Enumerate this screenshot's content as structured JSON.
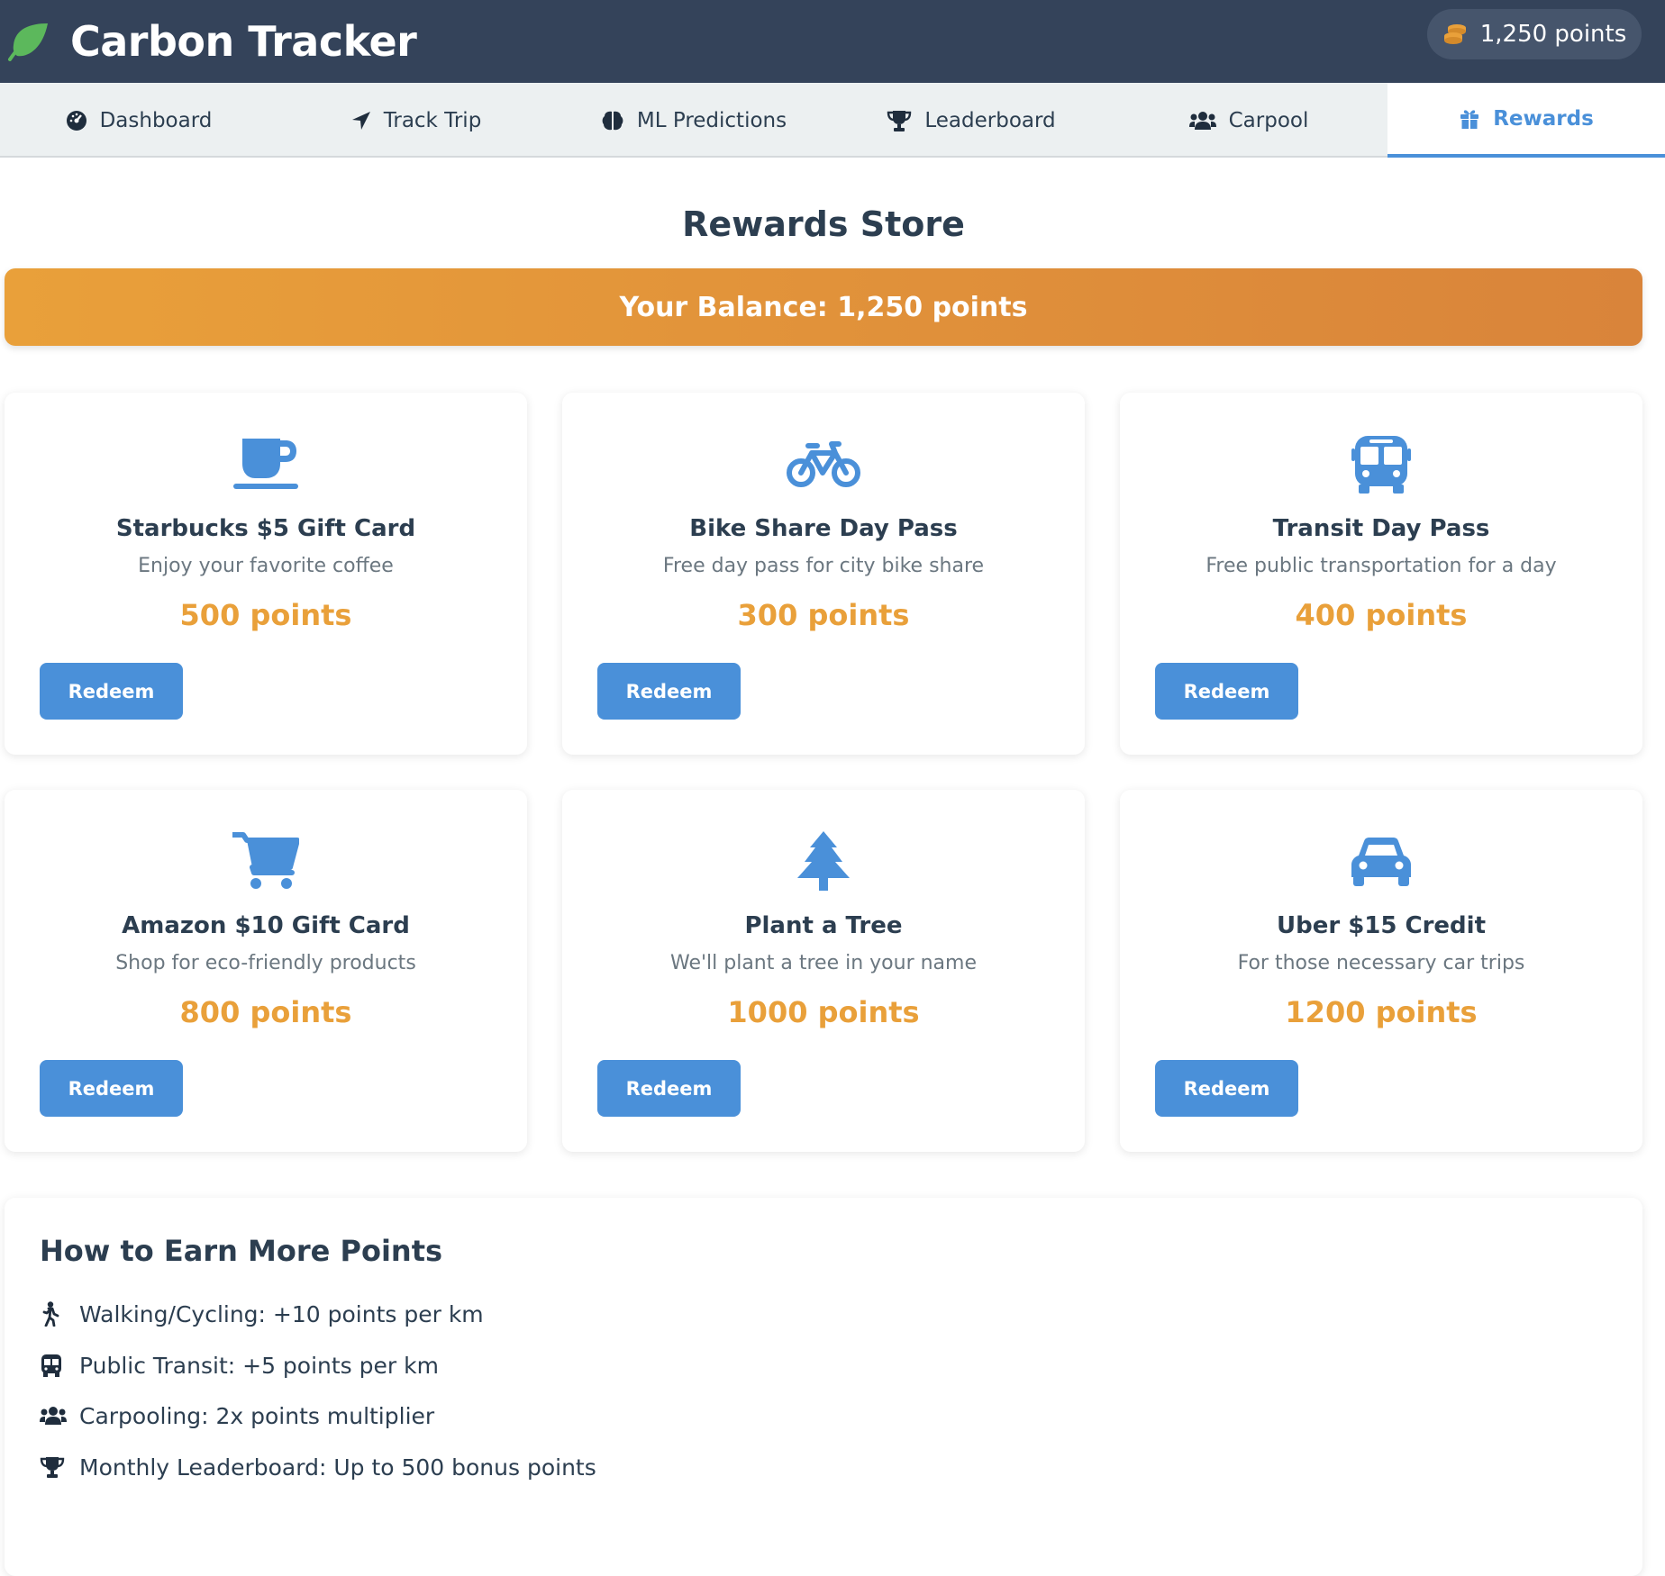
{
  "header": {
    "app_title": "Carbon Tracker",
    "points_display": "1,250 points",
    "logo_icon": "leaf-icon",
    "points_icon": "coins-icon"
  },
  "nav": {
    "tabs": [
      {
        "label": "Dashboard",
        "icon": "gauge-icon",
        "active": false
      },
      {
        "label": "Track Trip",
        "icon": "location-arrow-icon",
        "active": false
      },
      {
        "label": "ML Predictions",
        "icon": "brain-icon",
        "active": false
      },
      {
        "label": "Leaderboard",
        "icon": "trophy-icon",
        "active": false
      },
      {
        "label": "Carpool",
        "icon": "users-icon",
        "active": false
      },
      {
        "label": "Rewards",
        "icon": "gift-icon",
        "active": true
      }
    ]
  },
  "store": {
    "title": "Rewards Store",
    "balance_text": "Your Balance: 1,250 points"
  },
  "rewards": [
    {
      "name": "Starbucks $5 Gift Card",
      "description": "Enjoy your favorite coffee",
      "cost": "500 points",
      "icon": "coffee-icon",
      "button": "Redeem"
    },
    {
      "name": "Bike Share Day Pass",
      "description": "Free day pass for city bike share",
      "cost": "300 points",
      "icon": "bicycle-icon",
      "button": "Redeem"
    },
    {
      "name": "Transit Day Pass",
      "description": "Free public transportation for a day",
      "cost": "400 points",
      "icon": "bus-icon",
      "button": "Redeem"
    },
    {
      "name": "Amazon $10 Gift Card",
      "description": "Shop for eco-friendly products",
      "cost": "800 points",
      "icon": "shopping-cart-icon",
      "button": "Redeem"
    },
    {
      "name": "Plant a Tree",
      "description": "We'll plant a tree in your name",
      "cost": "1000 points",
      "icon": "tree-icon",
      "button": "Redeem"
    },
    {
      "name": "Uber $15 Credit",
      "description": "For those necessary car trips",
      "cost": "1200 points",
      "icon": "car-icon",
      "button": "Redeem"
    }
  ],
  "earn": {
    "title": "How to Earn More Points",
    "items": [
      {
        "text": "Walking/Cycling: +10 points per km",
        "icon": "walking-icon"
      },
      {
        "text": "Public Transit: +5 points per km",
        "icon": "bus-icon"
      },
      {
        "text": "Carpooling: 2x points multiplier",
        "icon": "users-icon"
      },
      {
        "text": "Monthly Leaderboard: Up to 500 bonus points",
        "icon": "trophy-icon"
      }
    ]
  },
  "colors": {
    "header_bg": "#34435a",
    "accent_blue": "#4a90d9",
    "points_orange": "#e9a03a",
    "leaf_green": "#5cb85c"
  }
}
